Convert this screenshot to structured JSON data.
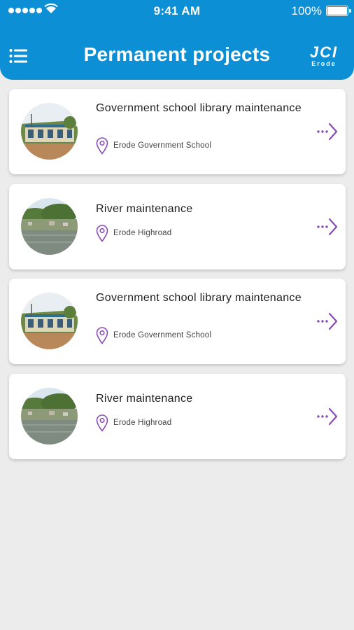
{
  "status_bar": {
    "time": "9:41 AM",
    "battery_percent": "100%"
  },
  "header": {
    "title": "Permanent projects",
    "logo_main": "JCI",
    "logo_sub": "Erode",
    "menu_icon": "hamburger-menu-icon"
  },
  "colors": {
    "header_bg": "#0d8fd6",
    "accent_purple": "#8a4bb6",
    "page_bg": "#ececec"
  },
  "projects": [
    {
      "title": "Government school library maintenance",
      "location": "Erode Government School",
      "image": "school-building"
    },
    {
      "title": "River maintenance",
      "location": "Erode Highroad",
      "image": "river"
    },
    {
      "title": "Government school library maintenance",
      "location": "Erode Government School",
      "image": "school-building"
    },
    {
      "title": "River maintenance",
      "location": "Erode Highroad",
      "image": "river"
    }
  ]
}
